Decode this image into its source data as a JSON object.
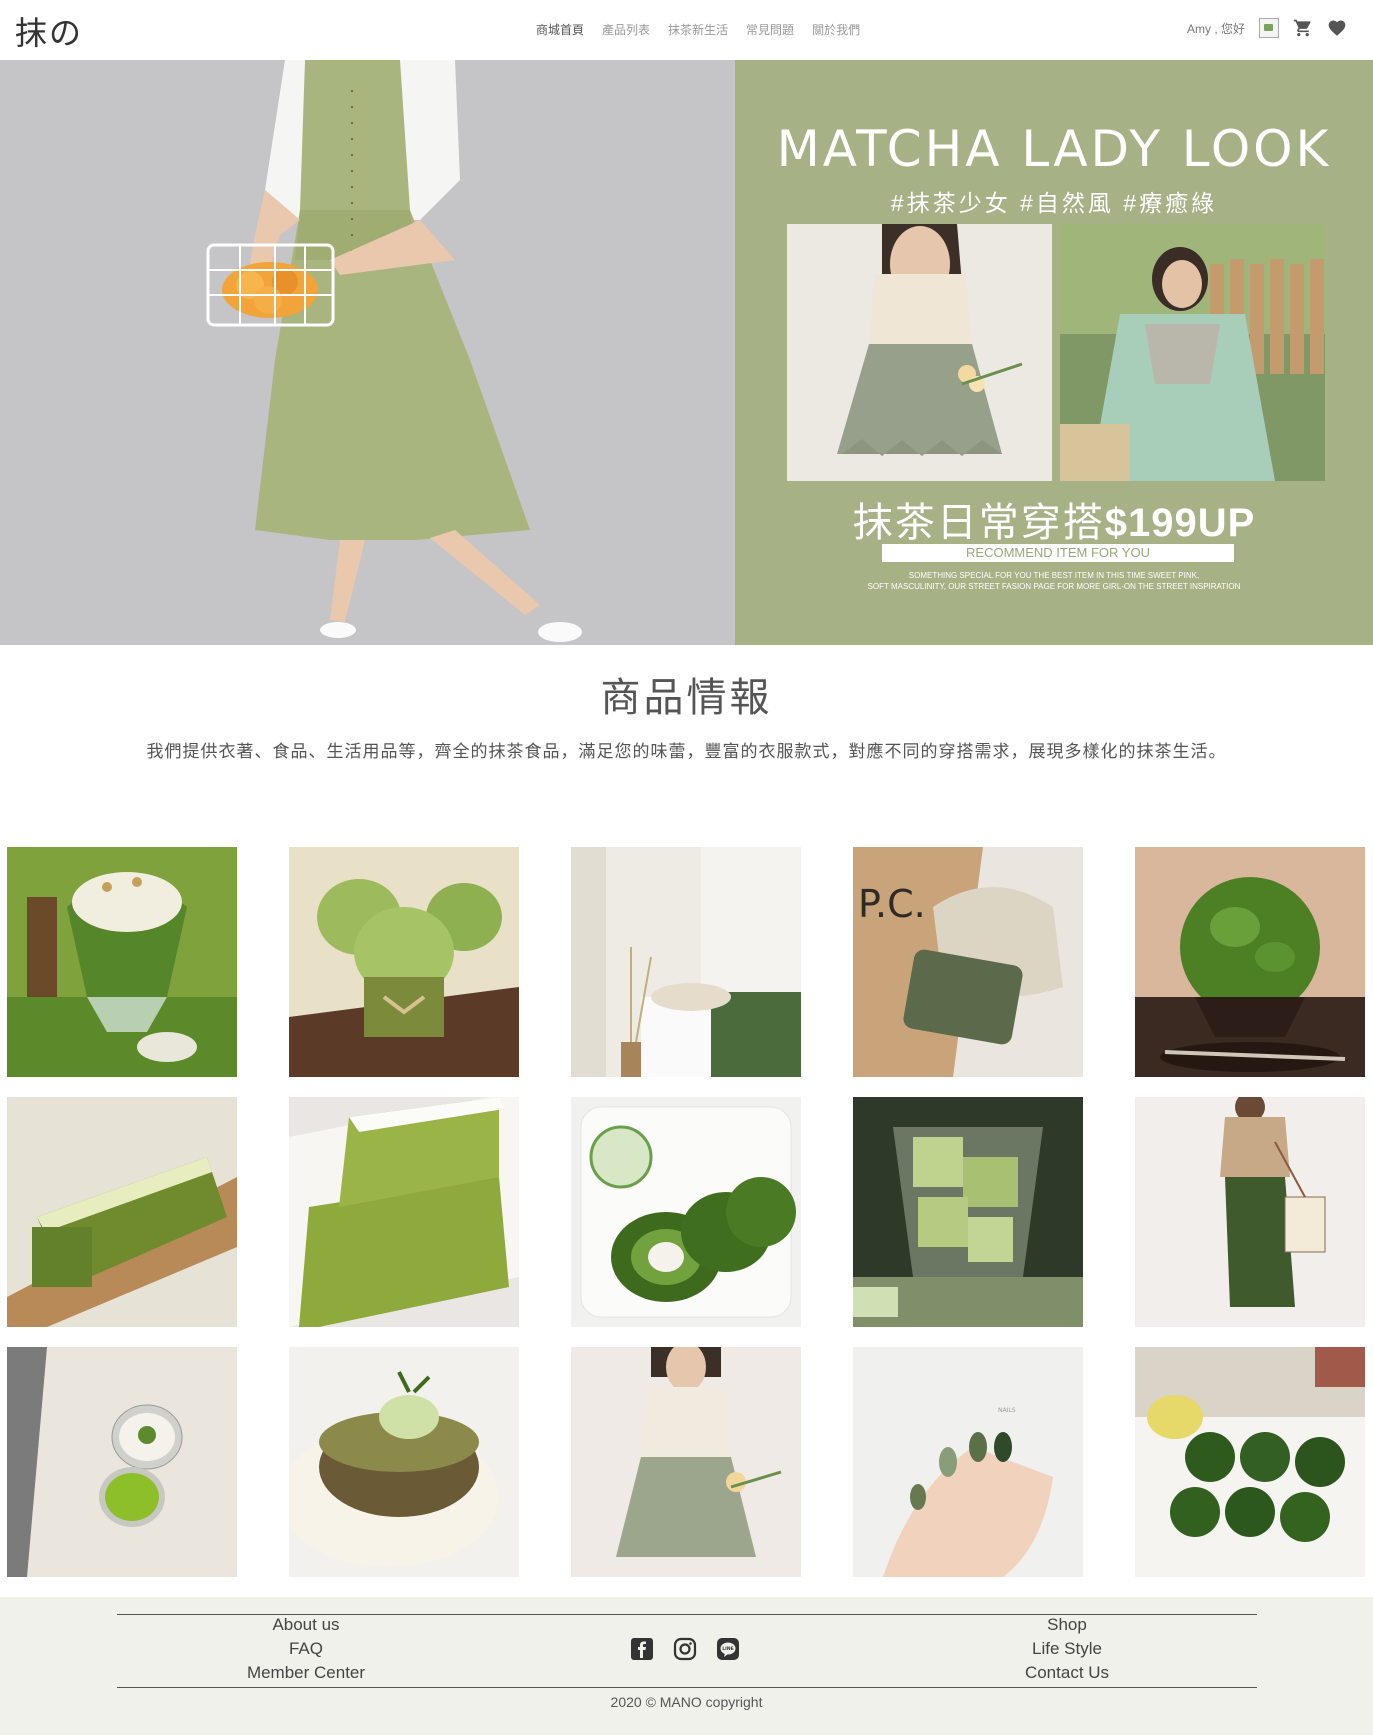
{
  "header": {
    "logo": "抹の",
    "nav": [
      "商城首頁",
      "產品列表",
      "抹茶新生活",
      "常見問題",
      "關於我們"
    ],
    "greeting": "Amy , 您好"
  },
  "hero": {
    "title": "MATCHA LADY LOOK",
    "tags": "#抹茶少女 #自然風 #療癒綠",
    "sub_text": "抹茶日常穿搭",
    "sub_price": "$199UP",
    "bar": "RECOMMEND ITEM FOR YOU",
    "small_line1": "SOMETHING SPECIAL FOR YOU THE BEST ITEM IN THIS TIME SWEET PINK,",
    "small_line2": "SOFT MASCULINITY, OUR STREET FASION PAGE FOR MORE GIRL-ON THE STREET INSPIRATION"
  },
  "section": {
    "title": "商品情報",
    "desc": "我們提供衣著、食品、生活用品等，齊全的抹茶食品，滿足您的味蕾，豐富的衣服款式，對應不同的穿搭需求，展現多樣化的抹茶生活。"
  },
  "footer": {
    "left_links": [
      "About us",
      "FAQ",
      "Member Center"
    ],
    "right_links": [
      "Shop",
      "Life Style",
      "Contact Us"
    ],
    "copyright": "2020 © MANO copyright"
  },
  "colors": {
    "accent": "#a6b185",
    "footer_bg": "#f0f1ea",
    "matcha": "#6f9a3c"
  }
}
